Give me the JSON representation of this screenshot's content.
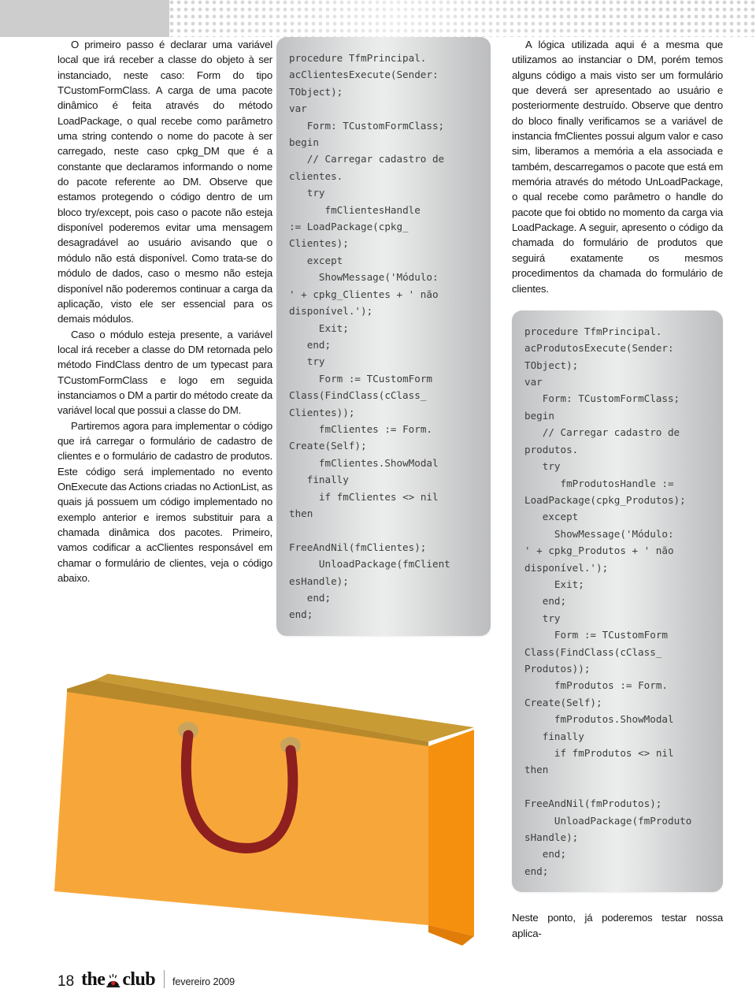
{
  "decor": {
    "band_color": "#cdcdcd",
    "dot_color": "#d4d4d4"
  },
  "columns": {
    "left": {
      "paragraphs": [
        "O primeiro passo é declarar uma variável local que irá receber a classe do objeto à ser instanciado, neste caso: Form do tipo TCustomFormClass. A carga de uma pacote dinâmico é feita através do método LoadPackage, o qual recebe como parâmetro uma string contendo o nome do pacote à ser carregado, neste caso cpkg_DM que é a constante que declaramos informando o nome do pacote referente ao DM. Observe que estamos protegendo o código dentro de um bloco try/except, pois caso o pacote não esteja disponível poderemos evitar uma mensagem desagradável ao usuário avisando que o módulo não está disponível. Como trata-se do módulo de dados, caso o mesmo não esteja disponível não poderemos continuar a carga da aplicação, visto ele ser essencial para os demais módulos.",
        "Caso o módulo esteja presente, a variável local irá receber a classe do DM retornada pelo método FindClass dentro de um typecast para TCustomFormClass e logo em seguida instanciamos o DM a partir do método create da variável local que possui a classe do DM.",
        "Partiremos agora para implementar o código que irá carregar o formulário de cadastro de clientes e o formulário de cadastro de produtos. Este código será implementado no evento OnExecute das Actions criadas no ActionList, as quais já possuem um código implementado no exemplo anterior e iremos substituir para a chamada dinâmica dos pacotes. Primeiro, vamos codificar a acClientes responsável em chamar o formulário de clientes, veja o código abaixo."
      ]
    },
    "middle": {
      "code": "procedure TfmPrincipal.\nacClientesExecute(Sender:\nTObject);\nvar\n   Form: TCustomFormClass;\nbegin\n   // Carregar cadastro de\nclientes.\n   try\n      fmClientesHandle\n:= LoadPackage(cpkg_\nClientes);\n   except\n     ShowMessage('Módulo:\n' + cpkg_Clientes + ' não\ndisponível.');\n     Exit;\n   end;\n   try\n     Form := TCustomForm\nClass(FindClass(cClass_\nClientes));\n     fmClientes := Form.\nCreate(Self);\n     fmClientes.ShowModal\n   finally\n     if fmClientes <> nil\nthen\n\nFreeAndNil(fmClientes);\n     UnloadPackage(fmClient\nesHandle);\n   end;\nend;"
    },
    "right": {
      "paragraphs": [
        "A lógica utilizada aqui é a mesma que utilizamos ao instanciar o DM, porém temos alguns código a mais visto ser um formulário que deverá ser apresentado ao usuário e posteriormente destruído. Observe que dentro do bloco finally verificamos se a variável de instancia fmClientes possui algum valor e caso sim, liberamos a memória a ela associada e também, descarregamos o pacote que está em memória através do método UnLoadPackage, o qual recebe como parâmetro o handle do pacote que foi obtido no momento da carga via LoadPackage. A seguir, apresento o código da chamada do formulário de produtos que seguirá exatamente os mesmos procedimentos da chamada do formulário de clientes."
      ],
      "code": "procedure TfmPrincipal.\nacProdutosExecute(Sender:\nTObject);\nvar\n   Form: TCustomFormClass;\nbegin\n   // Carregar cadastro de\nprodutos.\n   try\n      fmProdutosHandle :=\nLoadPackage(cpkg_Produtos);\n   except\n     ShowMessage('Módulo:\n' + cpkg_Produtos + ' não\ndisponível.');\n     Exit;\n   end;\n   try\n     Form := TCustomForm\nClass(FindClass(cClass_\nProdutos));\n     fmProdutos := Form.\nCreate(Self);\n     fmProdutos.ShowModal\n   finally\n     if fmProdutos <> nil\nthen\n\nFreeAndNil(fmProdutos);\n     UnloadPackage(fmProduto\nsHandle);\n   end;\nend;",
      "tail_text": "Neste ponto, já poderemos testar nossa aplica-"
    }
  },
  "illustration": {
    "name": "shopping-bag",
    "bag_front_color": "#f7a73a",
    "bag_side_color": "#f5900f",
    "bag_top_color": "#c99b35",
    "handle_color": "#8e1f1f",
    "grommet_color": "#c9a45c"
  },
  "footer": {
    "page_number": "18",
    "logo_the": "the",
    "logo_club": "club",
    "issue": "fevereiro 2009"
  }
}
